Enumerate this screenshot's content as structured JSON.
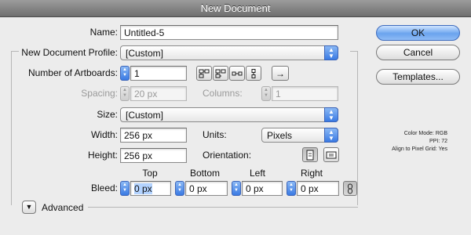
{
  "window": {
    "title": "New Document"
  },
  "name": {
    "label": "Name:",
    "value": "Untitled-5"
  },
  "profile": {
    "label": "New Document Profile:",
    "value": "[Custom]"
  },
  "artboards": {
    "label": "Number of Artboards:",
    "value": "1",
    "arrange_arrow": "→"
  },
  "spacing": {
    "label": "Spacing:",
    "value": "20 px"
  },
  "columns": {
    "label": "Columns:",
    "value": "1"
  },
  "size": {
    "label": "Size:",
    "value": "[Custom]"
  },
  "width": {
    "label": "Width:",
    "value": "256 px"
  },
  "height": {
    "label": "Height:",
    "value": "256 px"
  },
  "units": {
    "label": "Units:",
    "value": "Pixels"
  },
  "orientation": {
    "label": "Orientation:"
  },
  "bleed": {
    "label": "Bleed:",
    "top": {
      "label": "Top",
      "value": "0 px"
    },
    "bottom": {
      "label": "Bottom",
      "value": "0 px"
    },
    "left": {
      "label": "Left",
      "value": "0 px"
    },
    "right": {
      "label": "Right",
      "value": "0 px"
    }
  },
  "advanced": {
    "label": "Advanced"
  },
  "buttons": {
    "ok": "OK",
    "cancel": "Cancel",
    "templates": "Templates..."
  },
  "info": {
    "color_mode": "Color Mode: RGB",
    "ppi": "PPI: 72",
    "align_grid": "Align to Pixel Grid: Yes"
  },
  "colors": {
    "accent": "#3a7ae3",
    "window_bg": "#ececec"
  }
}
